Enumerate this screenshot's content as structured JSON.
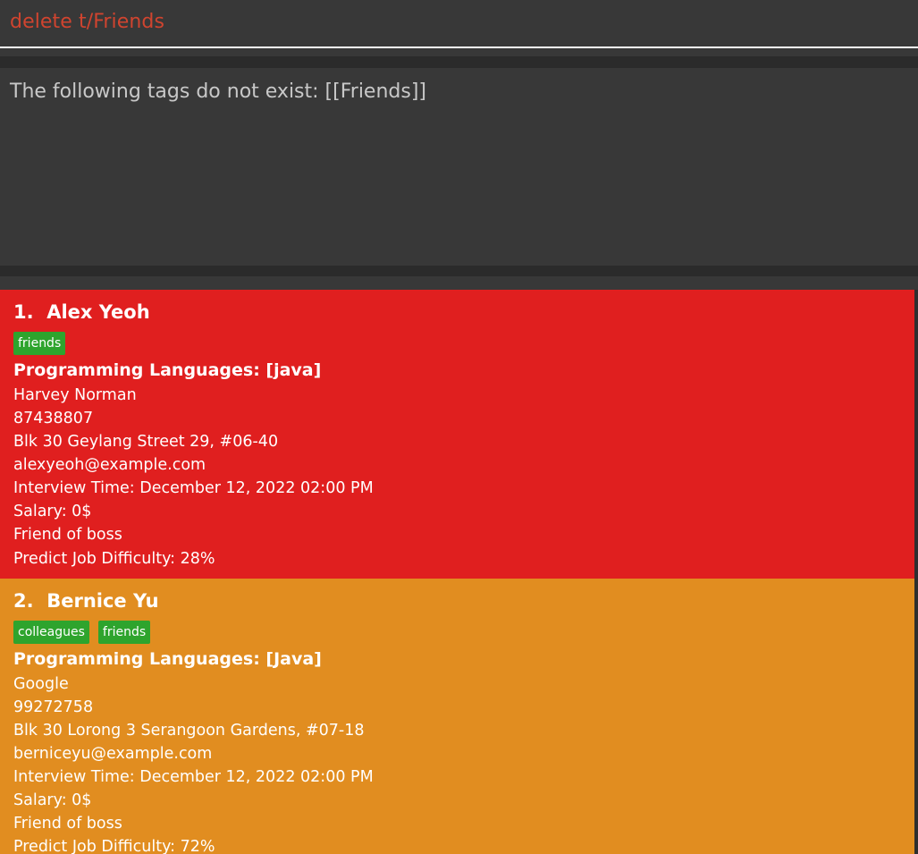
{
  "command_box": {
    "input_value": "delete t/Friends"
  },
  "result_display": {
    "message": "The following tags do not exist: [[Friends]]"
  },
  "person_list": {
    "persons": [
      {
        "index": "1.",
        "name": "Alex Yeoh",
        "card_color": "#e01f1f",
        "tags": [
          "friends"
        ],
        "programming_languages": "Programming Languages: [java]",
        "company": "Harvey Norman",
        "phone": "87438807",
        "address": "Blk 30 Geylang Street 29, #06-40",
        "email": "alexyeoh@example.com",
        "interview_time": "Interview Time: December 12, 2022 02:00 PM",
        "salary": "Salary: 0$",
        "remark": "Friend of boss",
        "difficulty": "Predict Job Difficulty: 28%"
      },
      {
        "index": "2.",
        "name": "Bernice Yu",
        "card_color": "#e18d20",
        "tags": [
          "colleagues",
          "friends"
        ],
        "programming_languages": "Programming Languages: [Java]",
        "company": "Google",
        "phone": "99272758",
        "address": "Blk 30 Lorong 3 Serangoon Gardens, #07-18",
        "email": "berniceyu@example.com",
        "interview_time": "Interview Time: December 12, 2022 02:00 PM",
        "salary": "Salary: 0$",
        "remark": "Friend of boss",
        "difficulty": "Predict Job Difficulty: 72%"
      }
    ]
  },
  "colors": {
    "tag_green": "#2ea42d",
    "command_text": "#d0442f"
  }
}
